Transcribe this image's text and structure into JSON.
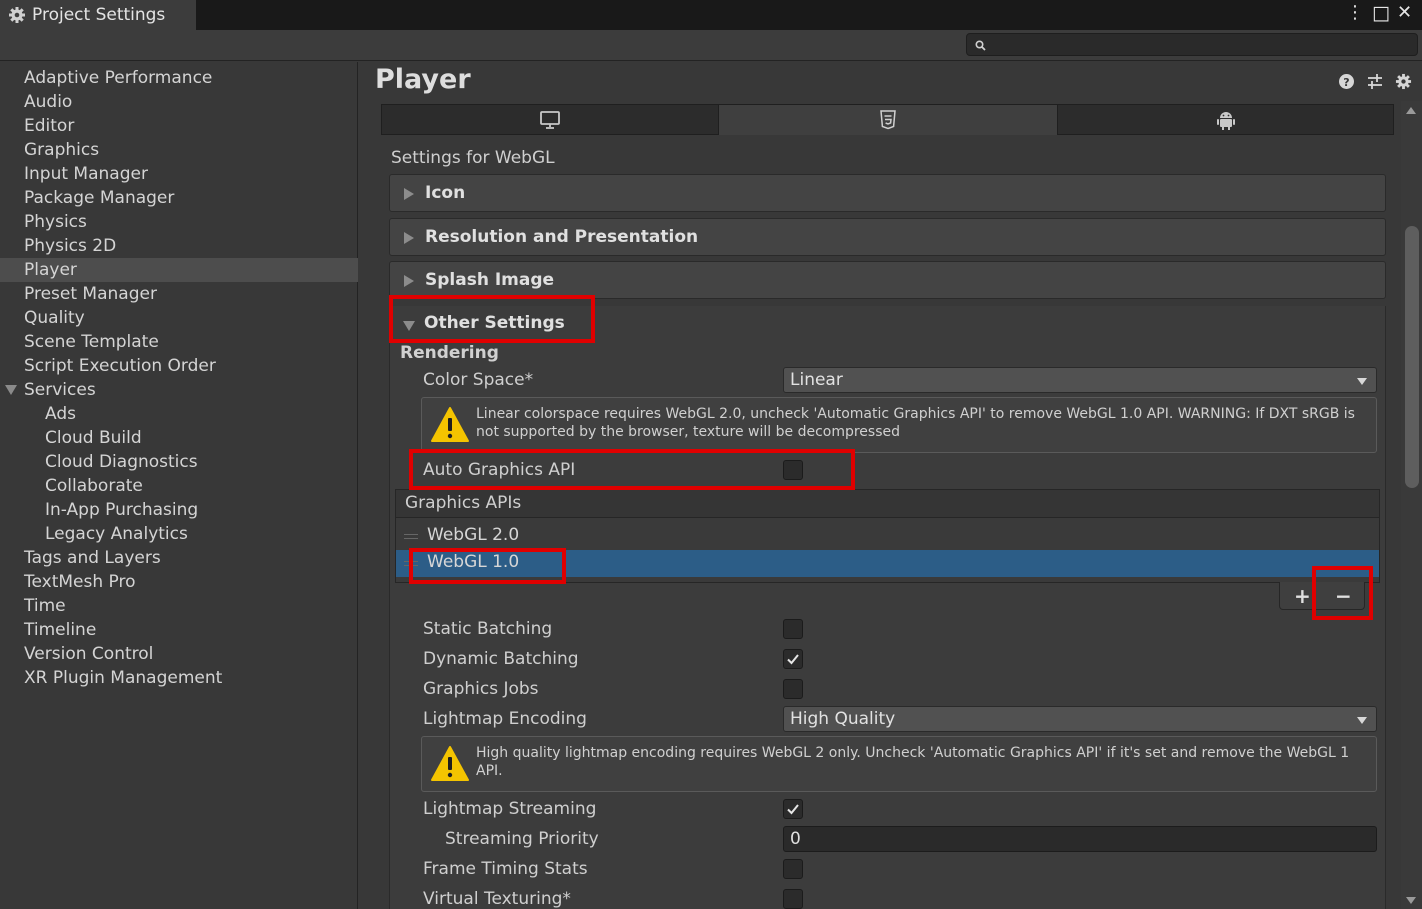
{
  "window": {
    "title": "Project Settings",
    "controls": [
      "⋮",
      "□",
      "✕"
    ]
  },
  "search": {
    "placeholder": "",
    "value": ""
  },
  "sidebar": {
    "items": [
      {
        "label": "Adaptive Performance"
      },
      {
        "label": "Audio"
      },
      {
        "label": "Editor"
      },
      {
        "label": "Graphics"
      },
      {
        "label": "Input Manager"
      },
      {
        "label": "Package Manager"
      },
      {
        "label": "Physics"
      },
      {
        "label": "Physics 2D"
      },
      {
        "label": "Player",
        "selected": true
      },
      {
        "label": "Preset Manager"
      },
      {
        "label": "Quality"
      },
      {
        "label": "Scene Template"
      },
      {
        "label": "Script Execution Order"
      },
      {
        "label": "Services",
        "expanded": true
      },
      {
        "label": "Ads",
        "child": true
      },
      {
        "label": "Cloud Build",
        "child": true
      },
      {
        "label": "Cloud Diagnostics",
        "child": true
      },
      {
        "label": "Collaborate",
        "child": true
      },
      {
        "label": "In-App Purchasing",
        "child": true
      },
      {
        "label": "Legacy Analytics",
        "child": true
      },
      {
        "label": "Tags and Layers"
      },
      {
        "label": "TextMesh Pro"
      },
      {
        "label": "Time"
      },
      {
        "label": "Timeline"
      },
      {
        "label": "Version Control"
      },
      {
        "label": "XR Plugin Management"
      }
    ]
  },
  "main": {
    "title": "Player",
    "header_icons": [
      "help-icon",
      "preset-icon",
      "gear-icon"
    ],
    "platform_tabs": [
      {
        "icon": "desktop-icon"
      },
      {
        "icon": "html5-icon",
        "active": true
      },
      {
        "icon": "android-icon"
      }
    ],
    "settings_for": "Settings for WebGL",
    "foldouts": {
      "icon": "Icon",
      "resolution": "Resolution and Presentation",
      "splash": "Splash Image",
      "other": "Other Settings"
    },
    "rendering": {
      "heading": "Rendering",
      "color_space_label": "Color Space*",
      "color_space_value": "Linear",
      "color_space_warning": "Linear colorspace requires WebGL 2.0, uncheck 'Automatic Graphics API' to remove WebGL 1.0 API. WARNING: If DXT sRGB is not supported by the browser, texture will be decompressed",
      "auto_graphics_label": "Auto Graphics API",
      "auto_graphics_checked": false,
      "graphics_apis_header": "Graphics APIs",
      "graphics_apis": [
        {
          "label": "WebGL 2.0",
          "selected": false
        },
        {
          "label": "WebGL 1.0",
          "selected": true
        }
      ],
      "add_label": "+",
      "remove_label": "−",
      "static_batching_label": "Static Batching",
      "static_batching": false,
      "dynamic_batching_label": "Dynamic Batching",
      "dynamic_batching": true,
      "graphics_jobs_label": "Graphics Jobs",
      "graphics_jobs": false,
      "lightmap_encoding_label": "Lightmap Encoding",
      "lightmap_encoding_value": "High Quality",
      "lightmap_warning": "High quality lightmap encoding requires WebGL 2 only. Uncheck 'Automatic Graphics API' if it's set and remove the WebGL 1 API.",
      "lightmap_streaming_label": "Lightmap Streaming",
      "lightmap_streaming": true,
      "streaming_priority_label": "Streaming Priority",
      "streaming_priority_value": "0",
      "frame_timing_label": "Frame Timing Stats",
      "frame_timing": false,
      "virtual_texturing_label": "Virtual Texturing*",
      "virtual_texturing": false
    }
  },
  "colors": {
    "background": "#383838",
    "selection": "#2c5d87",
    "annotation": "#e00000",
    "warning": "#f4c400"
  }
}
